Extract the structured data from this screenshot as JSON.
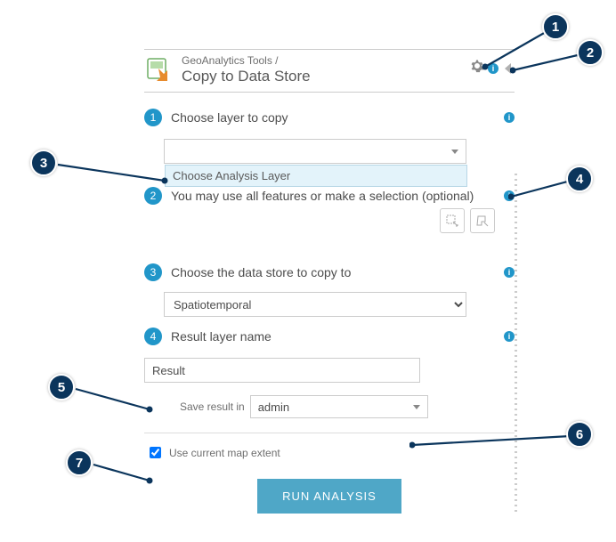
{
  "header": {
    "breadcrumb": "GeoAnalytics Tools  /",
    "title": "Copy to Data Store"
  },
  "steps": {
    "s1": {
      "num": "1",
      "label": "Choose layer to copy"
    },
    "s1_option": "Choose Analysis Layer",
    "s2": {
      "num": "2",
      "label": "You may use all features or make a selection (optional)"
    },
    "s3": {
      "num": "3",
      "label": "Choose the data store to copy to"
    },
    "s3_value": "Spatiotemporal",
    "s4": {
      "num": "4",
      "label": "Result layer name"
    },
    "result_value": "Result",
    "save_label": "Save result in",
    "save_value": "admin",
    "extent_label": "Use current map extent",
    "run_label": "RUN ANALYSIS"
  },
  "callouts": {
    "c1": "1",
    "c2": "2",
    "c3": "3",
    "c4": "4",
    "c5": "5",
    "c6": "6",
    "c7": "7"
  }
}
